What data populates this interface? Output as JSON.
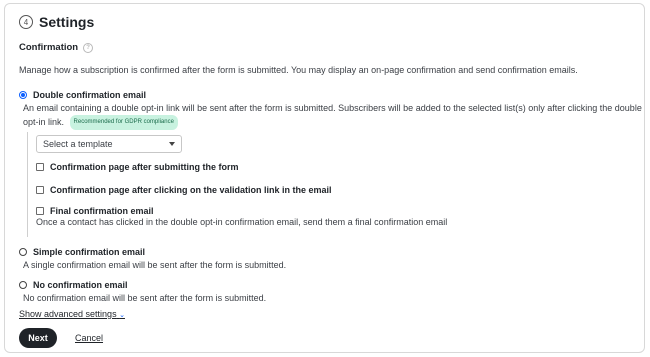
{
  "header": {
    "step_number": "4",
    "title": "Settings"
  },
  "confirmation": {
    "label": "Confirmation",
    "description": "Manage how a subscription is confirmed after the form is submitted. You may display an on-page confirmation and send confirmation emails."
  },
  "options": {
    "double": {
      "label": "Double confirmation email",
      "desc_line1": "An email containing a double opt-in link will be sent after the form is submitted. Subscribers will be added to the selected list(s) only after clicking the double",
      "desc_line2": "opt-in link.",
      "badge": "Recommended for GDPR compliance",
      "template_select": {
        "value": "Select a template"
      },
      "checks": [
        {
          "label": "Confirmation page after submitting the form"
        },
        {
          "label": "Confirmation page after clicking on the validation link in the email"
        },
        {
          "label": "Final confirmation email",
          "desc": "Once a contact has clicked in the double opt-in confirmation email, send them a final confirmation email"
        }
      ]
    },
    "simple": {
      "label": "Simple confirmation email",
      "desc": "A single confirmation email will be sent after the form is submitted."
    },
    "none": {
      "label": "No confirmation email",
      "desc": "No confirmation email will be sent after the form is submitted."
    }
  },
  "advanced": {
    "label": "Show advanced settings"
  },
  "footer": {
    "next_label": "Next",
    "cancel_label": "Cancel"
  },
  "colors": {
    "accent": "#0b5fff",
    "primary_button": "#1f2328",
    "badge_bg": "#c8f2e0"
  }
}
